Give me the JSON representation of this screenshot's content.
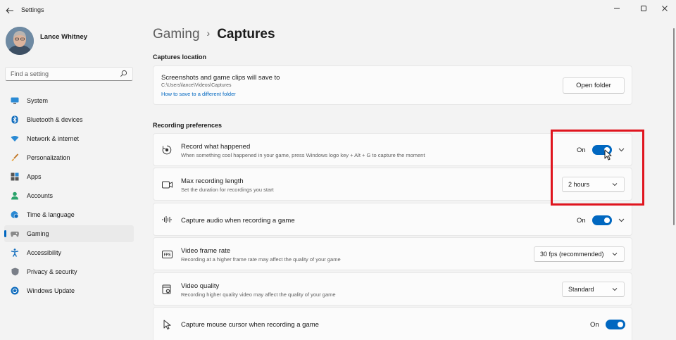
{
  "window": {
    "title": "Settings",
    "minimize": "—",
    "maximize": "☐",
    "close": "✕"
  },
  "user": {
    "name": "Lance Whitney"
  },
  "search": {
    "placeholder": "Find a setting"
  },
  "nav": [
    {
      "label": "System",
      "icon": "monitor-icon",
      "active": false
    },
    {
      "label": "Bluetooth & devices",
      "icon": "bluetooth-icon",
      "active": false
    },
    {
      "label": "Network & internet",
      "icon": "wifi-icon",
      "active": false
    },
    {
      "label": "Personalization",
      "icon": "brush-icon",
      "active": false
    },
    {
      "label": "Apps",
      "icon": "apps-icon",
      "active": false
    },
    {
      "label": "Accounts",
      "icon": "person-icon",
      "active": false
    },
    {
      "label": "Time & language",
      "icon": "globe-clock-icon",
      "active": false
    },
    {
      "label": "Gaming",
      "icon": "gamepad-icon",
      "active": true
    },
    {
      "label": "Accessibility",
      "icon": "accessibility-icon",
      "active": false
    },
    {
      "label": "Privacy & security",
      "icon": "shield-icon",
      "active": false
    },
    {
      "label": "Windows Update",
      "icon": "update-icon",
      "active": false
    }
  ],
  "breadcrumb": {
    "parent": "Gaming",
    "separator": "›",
    "current": "Captures"
  },
  "captures_location": {
    "section_title": "Captures location",
    "title": "Screenshots and game clips will save to",
    "path": "C:\\Users\\lance\\Videos\\Captures",
    "link": "How to save to a different folder",
    "button": "Open folder"
  },
  "recording_preferences": {
    "section_title": "Recording preferences",
    "record_what_happened": {
      "title": "Record what happened",
      "subtitle": "When something cool happened in your game, press Windows logo key + Alt + G to capture the moment",
      "state": "On",
      "icon": "record-icon"
    },
    "max_recording_length": {
      "title": "Max recording length",
      "subtitle": "Set the duration for recordings you start",
      "value": "2 hours",
      "icon": "video-camera-icon"
    },
    "capture_audio": {
      "title": "Capture audio when recording a game",
      "state": "On",
      "icon": "audio-wave-icon"
    },
    "video_frame_rate": {
      "title": "Video frame rate",
      "subtitle": "Recording at a higher frame rate may affect the quality of your game",
      "value": "30 fps (recommended)",
      "icon": "fps-icon"
    },
    "video_quality": {
      "title": "Video quality",
      "subtitle": "Recording higher quality video may affect the quality of your game",
      "value": "Standard",
      "icon": "video-settings-icon"
    },
    "capture_mouse_cursor": {
      "title": "Capture mouse cursor when recording a game",
      "state": "On",
      "icon": "mouse-pointer-icon"
    }
  },
  "colors": {
    "accent": "#0067c0",
    "highlight": "#e0151f",
    "link": "#0067c0"
  }
}
